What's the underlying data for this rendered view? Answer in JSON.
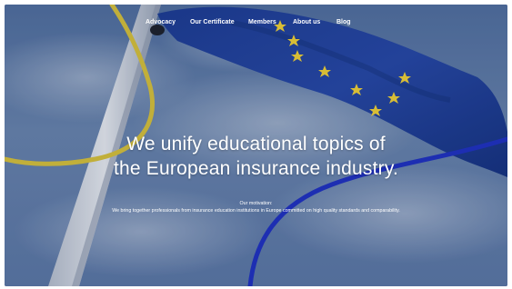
{
  "nav": {
    "items": [
      {
        "label": "Advocacy"
      },
      {
        "label": "Our Certificate"
      },
      {
        "label": "Members"
      },
      {
        "label": "About us"
      },
      {
        "label": "Blog"
      }
    ]
  },
  "hero": {
    "title_line1": "We unify educational topics of",
    "title_line2": "the European insurance industry."
  },
  "motivation": {
    "heading": "Our motivation:",
    "text": "We bring together professionals from insurance education institutions in Europe committed on high quality standards and comparability."
  },
  "colors": {
    "sky": "#5d7aa8",
    "flag_blue": "#1f3f9a",
    "star_yellow": "#f2d234",
    "curve_yellow": "#d8c23a",
    "curve_blue": "#1d2fc2",
    "text": "#ffffff"
  }
}
